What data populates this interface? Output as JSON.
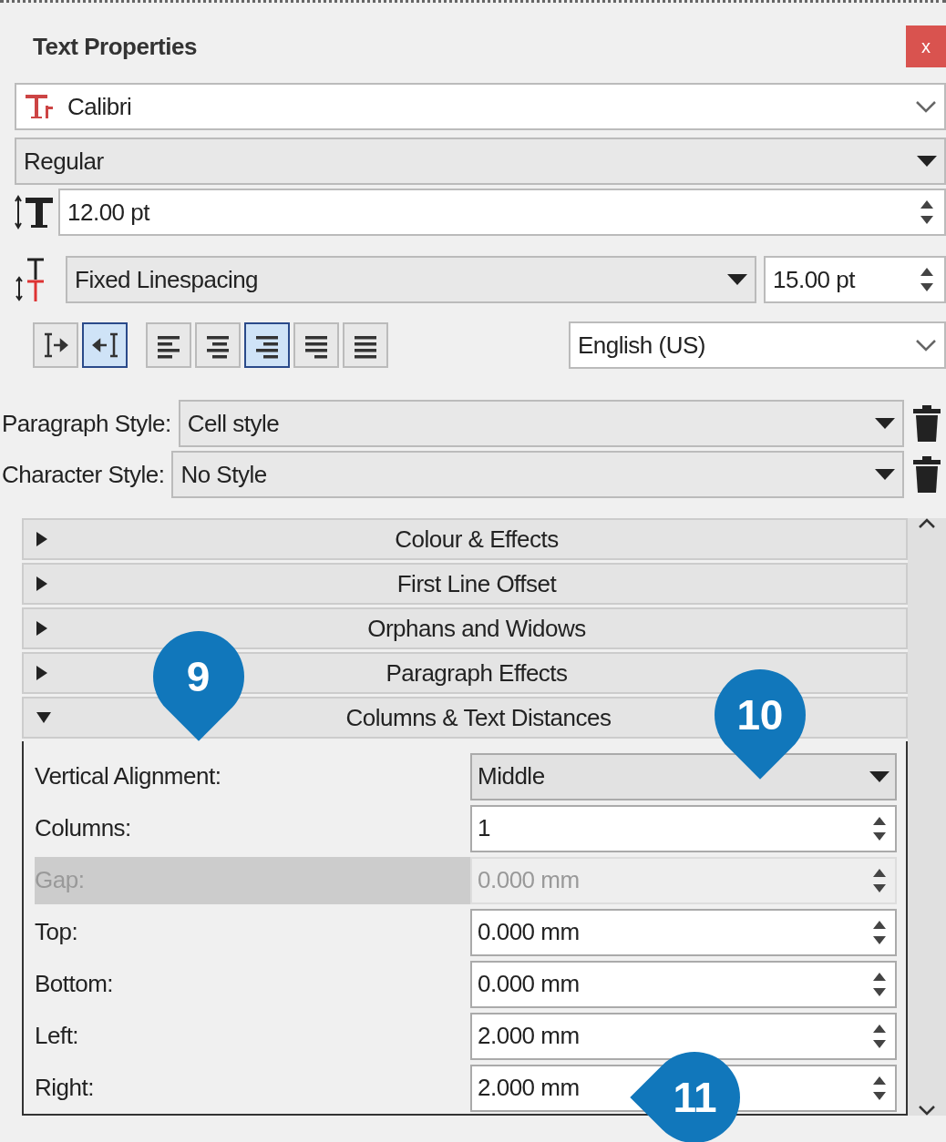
{
  "window": {
    "title": "Text Properties",
    "close": "x"
  },
  "font": {
    "family": "Calibri",
    "style": "Regular",
    "size": "12.00 pt"
  },
  "linespacing": {
    "mode": "Fixed Linespacing",
    "value": "15.00 pt"
  },
  "direction_buttons": [
    {
      "kind": "ltr",
      "selected": false
    },
    {
      "kind": "rtl",
      "selected": true
    }
  ],
  "alignment_buttons": [
    {
      "kind": "left",
      "selected": false
    },
    {
      "kind": "center",
      "selected": false
    },
    {
      "kind": "right",
      "selected": true
    },
    {
      "kind": "block",
      "selected": false
    },
    {
      "kind": "justify",
      "selected": false
    }
  ],
  "language": "English (US)",
  "styles": [
    {
      "label": "Paragraph Style:",
      "value": "Cell style"
    },
    {
      "label": "Character Style:",
      "value": "No Style"
    }
  ],
  "sections": [
    {
      "title": "Colour & Effects",
      "expanded": false
    },
    {
      "title": "First Line Offset",
      "expanded": false
    },
    {
      "title": "Orphans and Widows",
      "expanded": false
    },
    {
      "title": "Paragraph Effects",
      "expanded": false
    },
    {
      "title": "Columns & Text Distances",
      "expanded": true
    }
  ],
  "distances": [
    {
      "label": "Vertical Alignment:",
      "value": "Middle",
      "kind": "dropdown",
      "disabled": false
    },
    {
      "label": "Columns:",
      "value": "1",
      "kind": "spin",
      "disabled": false
    },
    {
      "label": "Gap:",
      "value": "0.000 mm",
      "kind": "spin",
      "disabled": true
    },
    {
      "label": "Top:",
      "value": "0.000 mm",
      "kind": "spin",
      "disabled": false
    },
    {
      "label": "Bottom:",
      "value": "0.000 mm",
      "kind": "spin",
      "disabled": false
    },
    {
      "label": "Left:",
      "value": "2.000 mm",
      "kind": "spin",
      "disabled": false
    },
    {
      "label": "Right:",
      "value": "2.000 mm",
      "kind": "spin",
      "disabled": false
    }
  ],
  "callouts": [
    {
      "number": "9",
      "kind": "down"
    },
    {
      "number": "10",
      "kind": "down"
    },
    {
      "number": "11",
      "kind": "left"
    }
  ]
}
